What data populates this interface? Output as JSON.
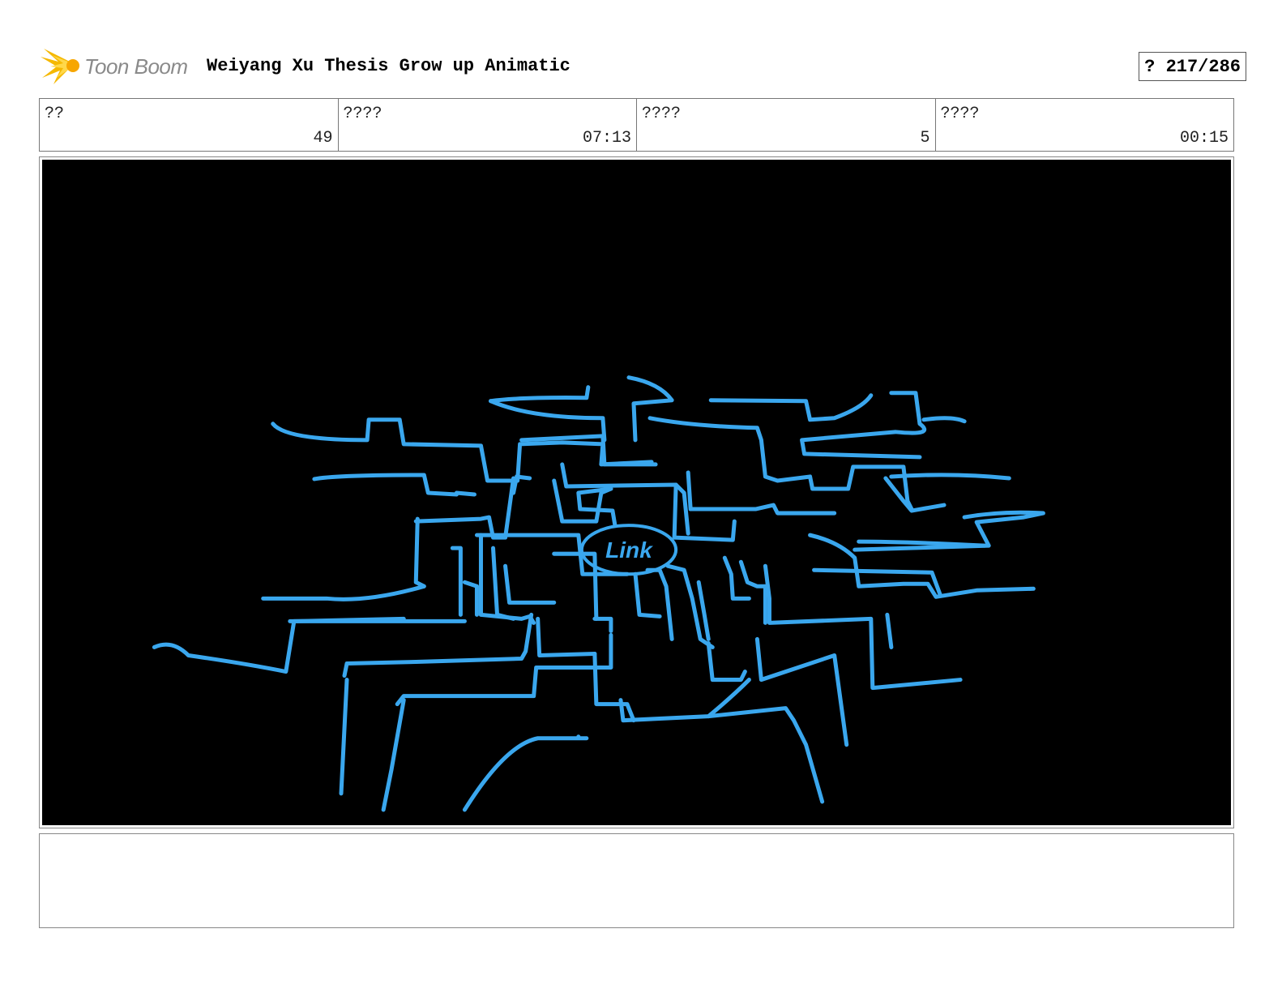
{
  "header": {
    "logo_text": "Toon Boom",
    "logo_icon": "toon-boom-starburst-icon",
    "project_title": "Weiyang Xu Thesis Grow up Animatic",
    "page_counter": "? 217/286"
  },
  "info": {
    "cells": [
      {
        "label": "??",
        "value": "49"
      },
      {
        "label": "????",
        "value": "07:13"
      },
      {
        "label": "????",
        "value": "5"
      },
      {
        "label": "????",
        "value": "00:15"
      }
    ]
  },
  "panel": {
    "center_label": "Link",
    "background_color": "#000000",
    "stroke_color": "#3aa7ee"
  },
  "notes": {
    "text": ""
  }
}
